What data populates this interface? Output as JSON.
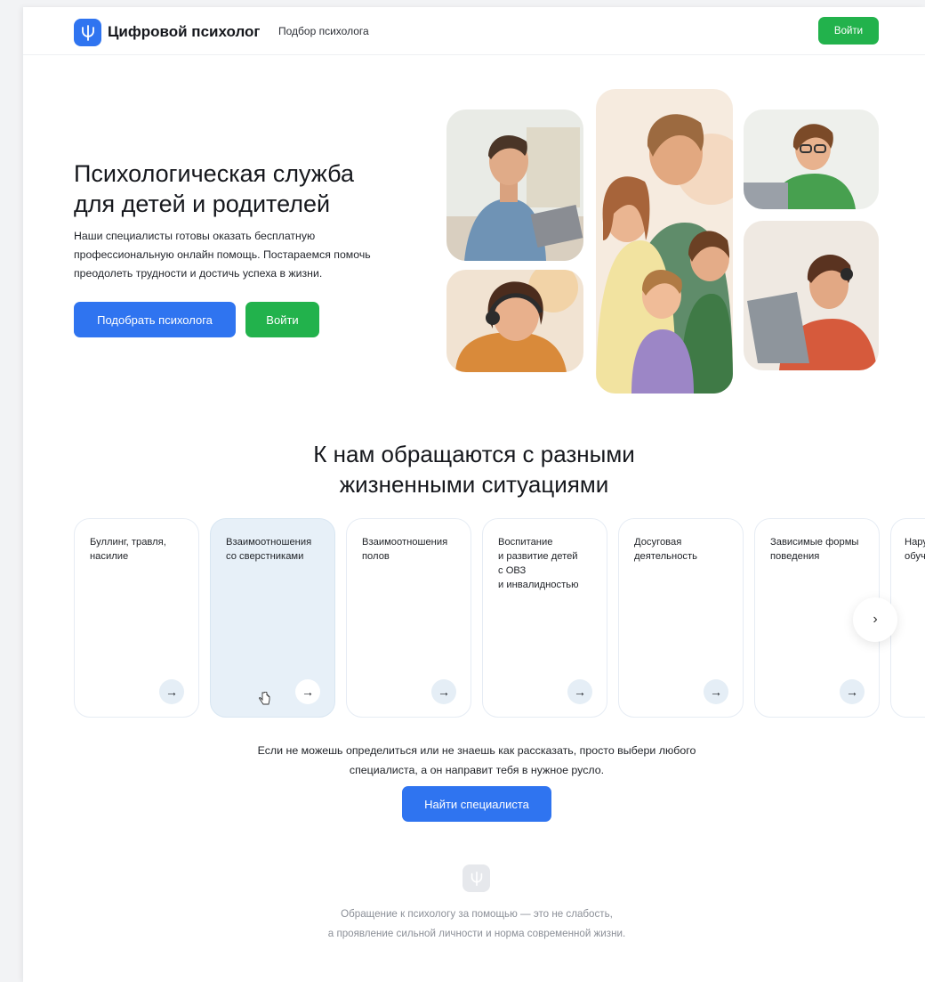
{
  "header": {
    "logo_text": "Цифровой психолог",
    "nav_link": "Подбор психолога",
    "login_button": "Войти"
  },
  "hero": {
    "title_line1": "Психологическая служба",
    "title_line2": "для детей и родителей",
    "text_line1": "Наши специалисты готовы оказать бесплатную",
    "text_line2": "профессиональную онлайн помощь. Постараемся помочь",
    "text_line3": "преодолеть трудности и достичь успеха в жизни.",
    "pick_button": "Подобрать психолога",
    "login_button": "Войти"
  },
  "situations": {
    "title_line1": "К нам обращаются с разными",
    "title_line2": "жизненными ситуациями",
    "cards": [
      {
        "label": "Буллинг, травля,\nнасилие"
      },
      {
        "label": "Взаимоотношения\nсо сверстниками"
      },
      {
        "label": "Взаимоотношения\nполов"
      },
      {
        "label": "Воспитание\nи развитие детей\nс ОВЗ\nи инвалидностью"
      },
      {
        "label": "Досуговая\nдеятельность"
      },
      {
        "label": "Зависимые формы\nповедения"
      },
      {
        "label": "Нару\nобуч"
      }
    ],
    "arrow_glyph": "→",
    "next_glyph": "›"
  },
  "help": {
    "text_line1": "Если не можешь определиться или не знаешь как рассказать, просто выбери любого",
    "text_line2": "специалиста, а он направит тебя в нужное русло.",
    "find_button": "Найти специалиста"
  },
  "footer": {
    "quote_line1": "Обращение к психологу за помощью — это не слабость,",
    "quote_line2": "а проявление сильной личности и норма современной жизни."
  },
  "colors": {
    "brand_blue": "#2f74f0",
    "action_green": "#22b24c",
    "active_card": "#e7f0f8"
  },
  "icons": {
    "logo": "psi-icon",
    "card_arrow": "arrow-right-icon",
    "scroll_next": "chevron-right-icon",
    "cursor": "hand-cursor-icon"
  }
}
